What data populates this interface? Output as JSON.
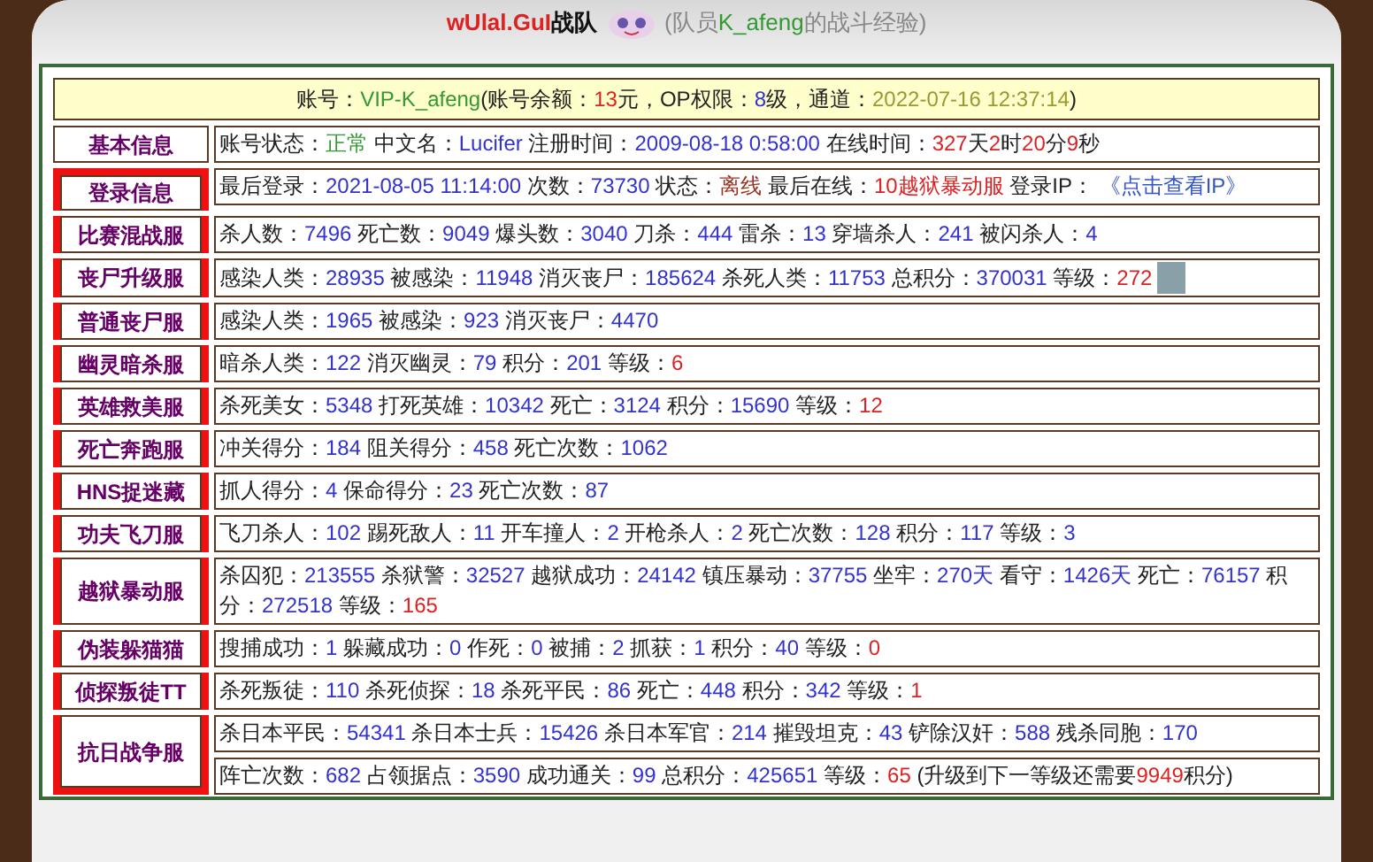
{
  "title": {
    "team": [
      {
        "kind": "red",
        "text": "wUlal.GuI"
      },
      {
        "kind": "bold",
        "text": "战队"
      }
    ],
    "member": [
      {
        "kind": "grey",
        "text": "(队员"
      },
      {
        "kind": "green",
        "text": "K_afeng"
      },
      {
        "kind": "grey",
        "text": "的战斗经验)"
      }
    ]
  },
  "account": [
    {
      "kind": "text",
      "text": "账号："
    },
    {
      "kind": "green",
      "text": "VIP-K_afeng"
    },
    {
      "kind": "text",
      "text": "(账号余额："
    },
    {
      "kind": "red",
      "text": "13"
    },
    {
      "kind": "text",
      "text": "元，OP权限："
    },
    {
      "kind": "num",
      "text": "8"
    },
    {
      "kind": "text",
      "text": "级，通道："
    },
    {
      "kind": "olive",
      "text": "2022-07-16 12:37:14"
    },
    {
      "kind": "text",
      "text": ")"
    }
  ],
  "rows": [
    {
      "label": "基本信息",
      "highlighted": false,
      "lines": [
        [
          {
            "kind": "text",
            "text": "账号状态："
          },
          {
            "kind": "green",
            "text": "正常"
          },
          {
            "kind": "text",
            "text": " 中文名："
          },
          {
            "kind": "num",
            "text": "Lucifer"
          },
          {
            "kind": "text",
            "text": " 注册时间："
          },
          {
            "kind": "num",
            "text": "2009-08-18 0:58:00"
          },
          {
            "kind": "text",
            "text": " 在线时间："
          },
          {
            "kind": "red",
            "text": "327"
          },
          {
            "kind": "text",
            "text": "天"
          },
          {
            "kind": "red",
            "text": "2"
          },
          {
            "kind": "text",
            "text": "时"
          },
          {
            "kind": "red",
            "text": "20"
          },
          {
            "kind": "text",
            "text": "分"
          },
          {
            "kind": "red",
            "text": "9"
          },
          {
            "kind": "text",
            "text": "秒"
          }
        ]
      ]
    },
    {
      "label": "登录信息",
      "highlighted": true,
      "lines": [
        [
          {
            "kind": "text",
            "text": "最后登录："
          },
          {
            "kind": "num",
            "text": "2021-08-05 11:14:00"
          },
          {
            "kind": "text",
            "text": " 次数："
          },
          {
            "kind": "num",
            "text": "73730"
          },
          {
            "kind": "text",
            "text": " 状态："
          },
          {
            "kind": "brown",
            "text": "离线"
          },
          {
            "kind": "text",
            "text": " 最后在线："
          },
          {
            "kind": "red",
            "text": "10越狱暴动服"
          },
          {
            "kind": "text",
            "text": " 登录IP： "
          },
          {
            "kind": "link",
            "text": "《点击查看IP》"
          }
        ]
      ]
    },
    {
      "label": "比赛混战服",
      "highlighted": true,
      "lines": [
        [
          {
            "kind": "text",
            "text": "杀人数："
          },
          {
            "kind": "num",
            "text": "7496"
          },
          {
            "kind": "text",
            "text": " 死亡数："
          },
          {
            "kind": "num",
            "text": "9049"
          },
          {
            "kind": "text",
            "text": " 爆头数："
          },
          {
            "kind": "num",
            "text": "3040"
          },
          {
            "kind": "text",
            "text": " 刀杀："
          },
          {
            "kind": "num",
            "text": "444"
          },
          {
            "kind": "text",
            "text": " 雷杀："
          },
          {
            "kind": "num",
            "text": "13"
          },
          {
            "kind": "text",
            "text": " 穿墙杀人："
          },
          {
            "kind": "num",
            "text": "241"
          },
          {
            "kind": "text",
            "text": " 被闪杀人："
          },
          {
            "kind": "num",
            "text": "4"
          }
        ]
      ]
    },
    {
      "label": "丧尸升级服",
      "highlighted": true,
      "lines": [
        [
          {
            "kind": "text",
            "text": "感染人类："
          },
          {
            "kind": "num",
            "text": "28935"
          },
          {
            "kind": "text",
            "text": " 被感染："
          },
          {
            "kind": "num",
            "text": "11948"
          },
          {
            "kind": "text",
            "text": " 消灭丧尸："
          },
          {
            "kind": "num",
            "text": "185624"
          },
          {
            "kind": "text",
            "text": " 杀死人类："
          },
          {
            "kind": "num",
            "text": "11753"
          },
          {
            "kind": "text",
            "text": " 总积分："
          },
          {
            "kind": "num",
            "text": "370031"
          },
          {
            "kind": "text",
            "text": " 等级："
          },
          {
            "kind": "red",
            "text": "272"
          },
          {
            "kind": "photo"
          }
        ]
      ]
    },
    {
      "label": "普通丧尸服",
      "highlighted": true,
      "lines": [
        [
          {
            "kind": "text",
            "text": "感染人类："
          },
          {
            "kind": "num",
            "text": "1965"
          },
          {
            "kind": "text",
            "text": " 被感染："
          },
          {
            "kind": "num",
            "text": "923"
          },
          {
            "kind": "text",
            "text": " 消灭丧尸："
          },
          {
            "kind": "num",
            "text": "4470"
          }
        ]
      ]
    },
    {
      "label": "幽灵暗杀服",
      "highlighted": true,
      "lines": [
        [
          {
            "kind": "text",
            "text": "暗杀人类："
          },
          {
            "kind": "num",
            "text": "122"
          },
          {
            "kind": "text",
            "text": " 消灭幽灵："
          },
          {
            "kind": "num",
            "text": "79"
          },
          {
            "kind": "text",
            "text": " 积分："
          },
          {
            "kind": "num",
            "text": "201"
          },
          {
            "kind": "text",
            "text": " 等级："
          },
          {
            "kind": "red",
            "text": "6"
          }
        ]
      ]
    },
    {
      "label": "英雄救美服",
      "highlighted": true,
      "lines": [
        [
          {
            "kind": "text",
            "text": "杀死美女："
          },
          {
            "kind": "num",
            "text": "5348"
          },
          {
            "kind": "text",
            "text": " 打死英雄："
          },
          {
            "kind": "num",
            "text": "10342"
          },
          {
            "kind": "text",
            "text": " 死亡："
          },
          {
            "kind": "num",
            "text": "3124"
          },
          {
            "kind": "text",
            "text": " 积分："
          },
          {
            "kind": "num",
            "text": "15690"
          },
          {
            "kind": "text",
            "text": " 等级："
          },
          {
            "kind": "red",
            "text": "12"
          }
        ]
      ]
    },
    {
      "label": "死亡奔跑服",
      "highlighted": true,
      "lines": [
        [
          {
            "kind": "text",
            "text": "冲关得分："
          },
          {
            "kind": "num",
            "text": "184"
          },
          {
            "kind": "text",
            "text": " 阻关得分："
          },
          {
            "kind": "num",
            "text": "458"
          },
          {
            "kind": "text",
            "text": " 死亡次数："
          },
          {
            "kind": "num",
            "text": "1062"
          }
        ]
      ]
    },
    {
      "label": "HNS捉迷藏",
      "highlighted": true,
      "lines": [
        [
          {
            "kind": "text",
            "text": "抓人得分："
          },
          {
            "kind": "num",
            "text": "4"
          },
          {
            "kind": "text",
            "text": " 保命得分："
          },
          {
            "kind": "num",
            "text": "23"
          },
          {
            "kind": "text",
            "text": " 死亡次数："
          },
          {
            "kind": "num",
            "text": "87"
          }
        ]
      ]
    },
    {
      "label": "功夫飞刀服",
      "highlighted": true,
      "lines": [
        [
          {
            "kind": "text",
            "text": "飞刀杀人："
          },
          {
            "kind": "num",
            "text": "102"
          },
          {
            "kind": "text",
            "text": " 踢死敌人："
          },
          {
            "kind": "num",
            "text": "11"
          },
          {
            "kind": "text",
            "text": " 开车撞人："
          },
          {
            "kind": "num",
            "text": "2"
          },
          {
            "kind": "text",
            "text": " 开枪杀人："
          },
          {
            "kind": "num",
            "text": "2"
          },
          {
            "kind": "text",
            "text": " 死亡次数："
          },
          {
            "kind": "num",
            "text": "128"
          },
          {
            "kind": "text",
            "text": " 积分："
          },
          {
            "kind": "num",
            "text": "117"
          },
          {
            "kind": "text",
            "text": " 等级："
          },
          {
            "kind": "num",
            "text": "3"
          }
        ]
      ]
    },
    {
      "label": "越狱暴动服",
      "highlighted": true,
      "lines": [
        [
          {
            "kind": "text",
            "text": "杀囚犯："
          },
          {
            "kind": "num",
            "text": "213555"
          },
          {
            "kind": "text",
            "text": " 杀狱警："
          },
          {
            "kind": "num",
            "text": "32527"
          },
          {
            "kind": "text",
            "text": " 越狱成功："
          },
          {
            "kind": "num",
            "text": "24142"
          },
          {
            "kind": "text",
            "text": " 镇压暴动："
          },
          {
            "kind": "num",
            "text": "37755"
          },
          {
            "kind": "text",
            "text": " 坐牢："
          },
          {
            "kind": "num",
            "text": "270天"
          },
          {
            "kind": "text",
            "text": " 看守："
          },
          {
            "kind": "num",
            "text": "1426天"
          },
          {
            "kind": "text",
            "text": " 死亡："
          },
          {
            "kind": "num",
            "text": "76157"
          },
          {
            "kind": "text",
            "text": " 积分："
          },
          {
            "kind": "num",
            "text": "272518"
          },
          {
            "kind": "text",
            "text": " 等级："
          },
          {
            "kind": "red",
            "text": "165"
          }
        ]
      ]
    },
    {
      "label": "伪装躲猫猫",
      "highlighted": true,
      "lines": [
        [
          {
            "kind": "text",
            "text": "搜捕成功："
          },
          {
            "kind": "num",
            "text": "1"
          },
          {
            "kind": "text",
            "text": " 躲藏成功："
          },
          {
            "kind": "num",
            "text": "0"
          },
          {
            "kind": "text",
            "text": " 作死："
          },
          {
            "kind": "num",
            "text": "0"
          },
          {
            "kind": "text",
            "text": " 被捕："
          },
          {
            "kind": "num",
            "text": "2"
          },
          {
            "kind": "text",
            "text": " 抓获："
          },
          {
            "kind": "num",
            "text": "1"
          },
          {
            "kind": "text",
            "text": " 积分："
          },
          {
            "kind": "num",
            "text": "40"
          },
          {
            "kind": "text",
            "text": " 等级："
          },
          {
            "kind": "red",
            "text": "0"
          }
        ]
      ]
    },
    {
      "label": "侦探叛徒TT",
      "highlighted": true,
      "lines": [
        [
          {
            "kind": "text",
            "text": "杀死叛徒："
          },
          {
            "kind": "num",
            "text": "110"
          },
          {
            "kind": "text",
            "text": " 杀死侦探："
          },
          {
            "kind": "num",
            "text": "18"
          },
          {
            "kind": "text",
            "text": " 杀死平民："
          },
          {
            "kind": "num",
            "text": "86"
          },
          {
            "kind": "text",
            "text": " 死亡："
          },
          {
            "kind": "num",
            "text": "448"
          },
          {
            "kind": "text",
            "text": " 积分："
          },
          {
            "kind": "num",
            "text": "342"
          },
          {
            "kind": "text",
            "text": " 等级："
          },
          {
            "kind": "red",
            "text": "1"
          }
        ]
      ]
    },
    {
      "label": "抗日战争服",
      "highlighted": true,
      "lines": [
        [
          {
            "kind": "text",
            "text": "杀日本平民："
          },
          {
            "kind": "num",
            "text": "54341"
          },
          {
            "kind": "text",
            "text": " 杀日本士兵："
          },
          {
            "kind": "num",
            "text": "15426"
          },
          {
            "kind": "text",
            "text": " 杀日本军官："
          },
          {
            "kind": "num",
            "text": "214"
          },
          {
            "kind": "text",
            "text": " 摧毁坦克："
          },
          {
            "kind": "num",
            "text": "43"
          },
          {
            "kind": "text",
            "text": " 铲除汉奸："
          },
          {
            "kind": "num",
            "text": "588"
          },
          {
            "kind": "text",
            "text": " 残杀同胞："
          },
          {
            "kind": "num",
            "text": "170"
          }
        ],
        [
          {
            "kind": "text",
            "text": "阵亡次数："
          },
          {
            "kind": "num",
            "text": "682"
          },
          {
            "kind": "text",
            "text": " 占领据点："
          },
          {
            "kind": "num",
            "text": "3590"
          },
          {
            "kind": "text",
            "text": " 成功通关："
          },
          {
            "kind": "num",
            "text": "99"
          },
          {
            "kind": "text",
            "text": " 总积分："
          },
          {
            "kind": "num",
            "text": "425651"
          },
          {
            "kind": "text",
            "text": " 等级："
          },
          {
            "kind": "red",
            "text": "65"
          },
          {
            "kind": "text",
            "text": " (升级到下一等级还需要"
          },
          {
            "kind": "red",
            "text": "9949"
          },
          {
            "kind": "text",
            "text": "积分)"
          }
        ]
      ]
    }
  ]
}
